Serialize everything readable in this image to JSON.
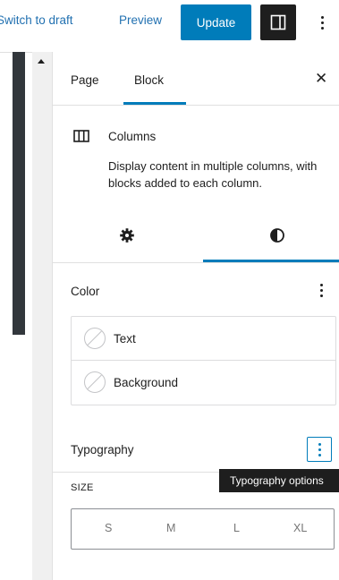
{
  "toolbar": {
    "switch_to_draft": "Switch to draft",
    "preview": "Preview",
    "update": "Update",
    "settings_icon": "sidebar-toggle-icon",
    "more_icon": "kebab-menu-icon"
  },
  "sidebar": {
    "tabs": [
      {
        "label": "Page",
        "active": false
      },
      {
        "label": "Block",
        "active": true
      }
    ],
    "close_icon": "close-icon",
    "block": {
      "icon": "columns-icon",
      "title": "Columns",
      "description": "Display content in multiple columns, with blocks added to each column."
    },
    "subtabs": [
      {
        "icon": "gear-icon",
        "active": false
      },
      {
        "icon": "contrast-icon",
        "active": true
      }
    ],
    "color": {
      "title": "Color",
      "items": [
        {
          "label": "Text"
        },
        {
          "label": "Background"
        }
      ]
    },
    "typography": {
      "title": "Typography",
      "tooltip": "Typography options",
      "size_label": "SIZE",
      "size_options": [
        "S",
        "M",
        "L",
        "XL"
      ]
    }
  },
  "colors": {
    "accent": "#007cba",
    "link": "#2271b1",
    "dark": "#1e1e1e"
  }
}
